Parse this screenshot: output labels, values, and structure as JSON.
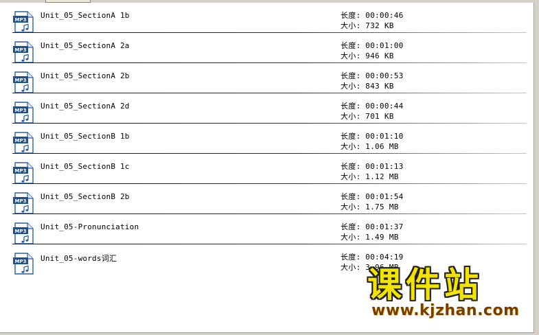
{
  "files": [
    {
      "name": "Unit_05_SectionA 1b",
      "length_label": "长度:",
      "length": "00:00:46",
      "size_label": "大小:",
      "size": "732 KB",
      "icon": "mp3-file-icon",
      "badge": "MP3"
    },
    {
      "name": "Unit_05_SectionA 2a",
      "length_label": "长度:",
      "length": "00:01:00",
      "size_label": "大小:",
      "size": "946 KB",
      "icon": "mp3-file-icon",
      "badge": "MP3"
    },
    {
      "name": "Unit_05_SectionA 2b",
      "length_label": "长度:",
      "length": "00:00:53",
      "size_label": "大小:",
      "size": "843 KB",
      "icon": "mp3-file-icon",
      "badge": "MP3"
    },
    {
      "name": "Unit_05_SectionA 2d",
      "length_label": "长度:",
      "length": "00:00:44",
      "size_label": "大小:",
      "size": "701 KB",
      "icon": "mp3-file-icon",
      "badge": "MP3"
    },
    {
      "name": "Unit_05_SectionB 1b",
      "length_label": "长度:",
      "length": "00:01:10",
      "size_label": "大小:",
      "size": "1.06 MB",
      "icon": "mp3-file-icon",
      "badge": "MP3"
    },
    {
      "name": "Unit_05_SectionB 1c",
      "length_label": "长度:",
      "length": "00:01:13",
      "size_label": "大小:",
      "size": "1.12 MB",
      "icon": "mp3-file-icon",
      "badge": "MP3"
    },
    {
      "name": "Unit_05_SectionB 2b",
      "length_label": "长度:",
      "length": "00:01:54",
      "size_label": "大小:",
      "size": "1.75 MB",
      "icon": "mp3-file-icon",
      "badge": "MP3"
    },
    {
      "name": "Unit_05-Pronunciation",
      "length_label": "长度:",
      "length": "00:01:37",
      "size_label": "大小:",
      "size": "1.49 MB",
      "icon": "mp3-file-icon",
      "badge": "MP3"
    },
    {
      "name": "Unit_05-words词汇",
      "length_label": "长度:",
      "length": "00:04:19",
      "size_label": "大小:",
      "size": "3.96 MB",
      "icon": "mp3-file-icon",
      "badge": "MP3"
    }
  ],
  "watermark": {
    "chinese": "课件站",
    "url": "www.kjzhan.com"
  },
  "colors": {
    "icon_blue": "#2a5d9c",
    "icon_badge": "#1f4f8f",
    "watermark_yellow": "#f2e400",
    "watermark_brown": "#7a3a00"
  }
}
